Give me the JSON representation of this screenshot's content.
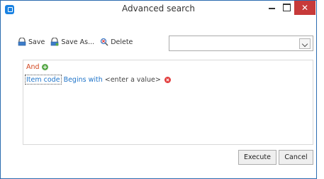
{
  "window": {
    "title": "Advanced search",
    "close_glyph": "✕"
  },
  "toolbar": {
    "items": [
      {
        "label": "Save",
        "icon": "save-icon"
      },
      {
        "label": "Save As...",
        "icon": "save-as-icon"
      },
      {
        "label": "Delete",
        "icon": "delete-icon"
      }
    ]
  },
  "saved_search_combo": {
    "value": ""
  },
  "builder": {
    "group_operator": "And",
    "conditions": [
      {
        "field": "Item code",
        "operator": "Begins with",
        "value": "<enter a value>"
      }
    ]
  },
  "buttons": {
    "execute": "Execute",
    "cancel": "Cancel"
  },
  "colors": {
    "accent": "#1a82e2",
    "close": "#c73a3a",
    "and": "#d2451e",
    "field": "#1f74c9",
    "add": "#5aa94b",
    "remove": "#e23c3c"
  }
}
